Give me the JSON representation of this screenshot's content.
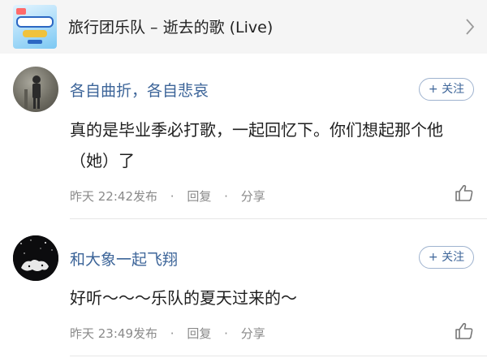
{
  "song": {
    "title": "旅行团乐队 – 逝去的歌 (Live)"
  },
  "comments": [
    {
      "username": "各自曲折，各自悲哀",
      "follow_label": "+ 关注",
      "text": "真的是毕业季必打歌，一起回忆下。你们想起那个他（她）了",
      "time": "昨天 22:42发布",
      "reply_label": "回复",
      "share_label": "分享"
    },
    {
      "username": "和大象一起飞翔",
      "follow_label": "+ 关注",
      "text": "好听～～～乐队的夏天过来的～",
      "time": "昨天 23:49发布",
      "reply_label": "回复",
      "share_label": "分享"
    }
  ],
  "separator": "·",
  "colors": {
    "username": "#3d6599",
    "meta": "#8a8a8a",
    "header_bg": "#f5f5f5"
  },
  "icons": [
    "chevron-right-icon",
    "thumbs-up-icon"
  ]
}
